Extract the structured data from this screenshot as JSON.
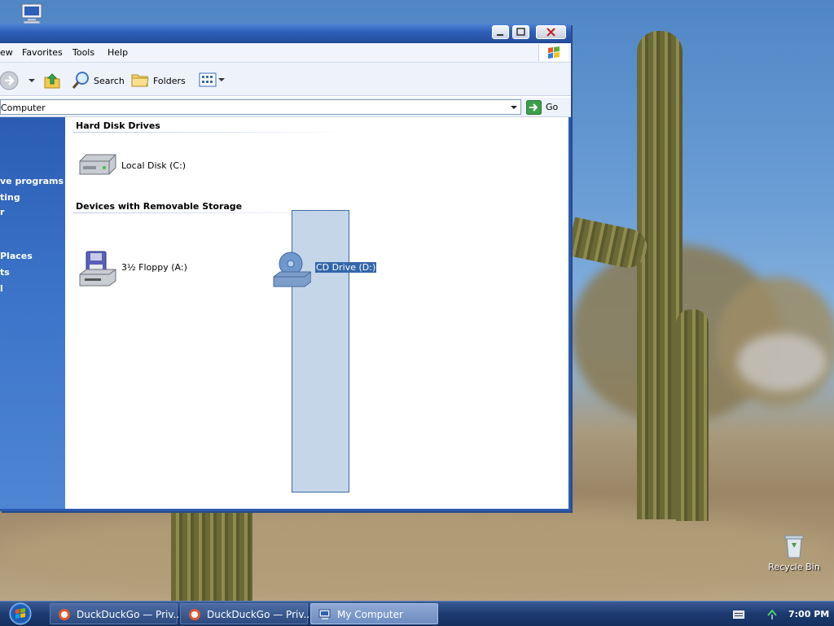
{
  "window": {
    "menu": [
      "ew",
      "Favorites",
      "Tools",
      "Help"
    ],
    "toolbar": {
      "search_label": "Search",
      "folders_label": "Folders"
    },
    "address": {
      "value": "Computer",
      "go_label": "Go"
    },
    "left_pane": {
      "links": [
        "ve programs",
        "ting",
        "r",
        "Places",
        "ts",
        "l"
      ]
    },
    "groups": [
      {
        "title": "Hard Disk Drives",
        "items": [
          {
            "label": "Local Disk (C:)",
            "icon": "hard-disk-icon"
          }
        ]
      },
      {
        "title": "Devices with Removable Storage",
        "items": [
          {
            "label": "3½ Floppy (A:)",
            "icon": "floppy-drive-icon"
          },
          {
            "label": "CD Drive (D:)",
            "icon": "cd-drive-icon",
            "selected": true
          }
        ]
      }
    ]
  },
  "desktop": {
    "recycle_bin_label": "Recycle Bin"
  },
  "taskbar": {
    "buttons": [
      {
        "label": "DuckDuckGo — Priv...",
        "active": false
      },
      {
        "label": "DuckDuckGo — Priv...",
        "active": false
      },
      {
        "label": "My Computer",
        "active": true
      }
    ],
    "clock": "7:00 PM"
  },
  "colors": {
    "title_blue": "#2d5fb8",
    "left_pane_blue": "#3a72c8",
    "selection": "#3366aa",
    "taskbar": "#1c3a70"
  }
}
